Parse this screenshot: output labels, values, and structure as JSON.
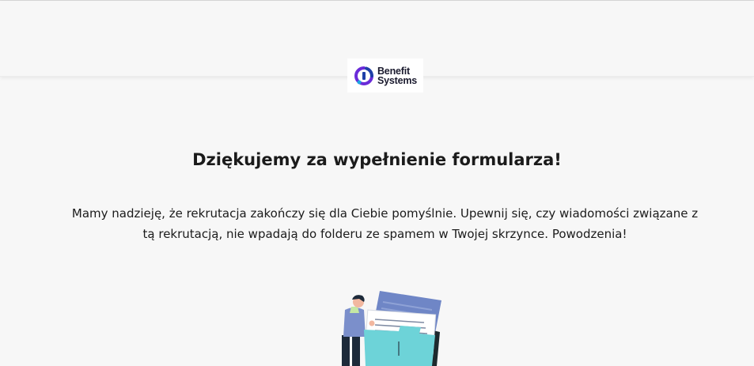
{
  "header": {
    "logo": {
      "line1": "Benefit",
      "line2": "Systems",
      "icon": "benefit-systems-logo-icon",
      "colors": {
        "purple": "#6a2bd9",
        "blue": "#1f3fa8",
        "dot": "#1ea7e1"
      }
    }
  },
  "main": {
    "title": "Dziękujemy za wypełnienie formularza!",
    "message": "Mamy nadzieję, że rekrutacja zakończy się dla Ciebie pomyślnie. Upewnij się, czy wiadomości związane z tą rekrutacją, nie wpadają do folderu ze spamem w Twojej skrzynce. Powodzenia!",
    "illustration": "person-holding-folder-illustration"
  },
  "colors": {
    "background": "#f7f7f7",
    "text": "#1b1b1b",
    "folder": "#6dd3d8",
    "document_back": "#6f86c6"
  }
}
